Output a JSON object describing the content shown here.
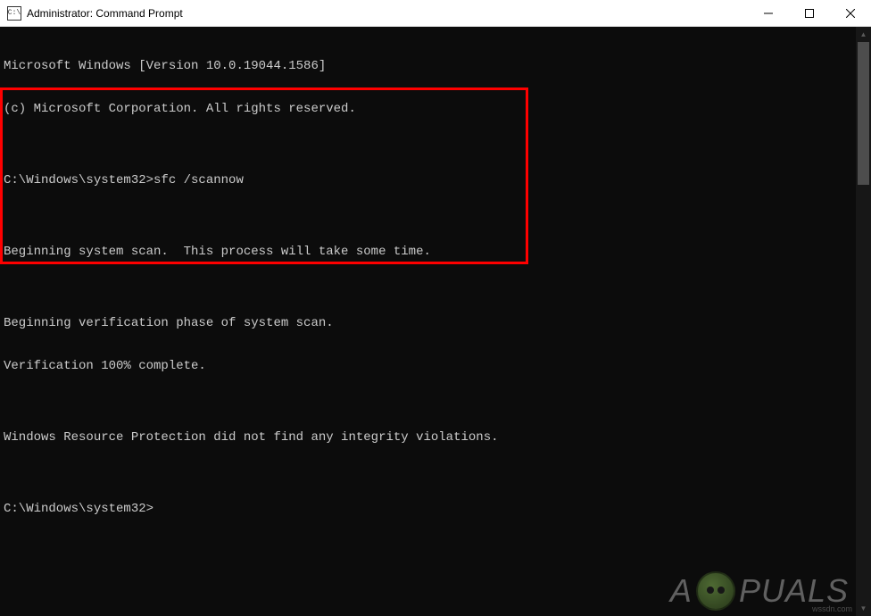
{
  "titlebar": {
    "icon_label": "C:\\",
    "title": "Administrator: Command Prompt"
  },
  "terminal": {
    "line1": "Microsoft Windows [Version 10.0.19044.1586]",
    "line2": "(c) Microsoft Corporation. All rights reserved.",
    "blank1": "",
    "prompt1": "C:\\Windows\\system32>sfc /scannow",
    "blank2": "",
    "scan_begin": "Beginning system scan.  This process will take some time.",
    "blank3": "",
    "verify_phase": "Beginning verification phase of system scan.",
    "verify_done": "Verification 100% complete.",
    "blank4": "",
    "result": "Windows Resource Protection did not find any integrity violations.",
    "blank5": "",
    "prompt2": "C:\\Windows\\system32>"
  },
  "watermark": {
    "text_left": "A",
    "text_right": "PUALS",
    "attrib": "wssdn.com"
  }
}
